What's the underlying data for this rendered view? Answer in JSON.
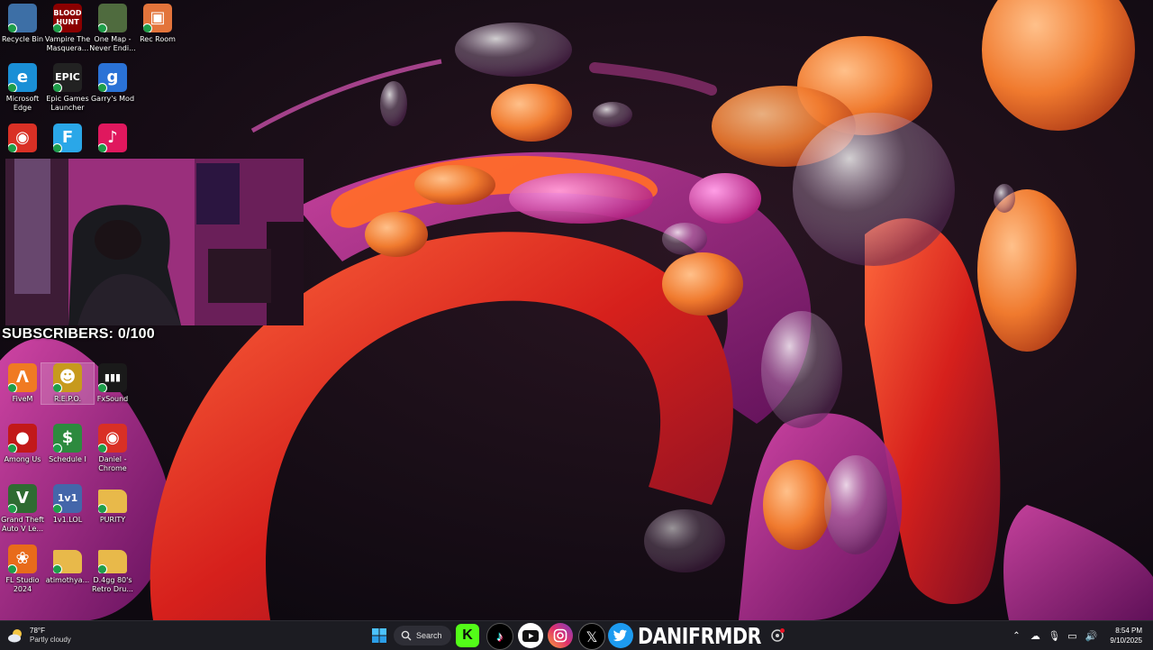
{
  "desktop": {
    "icons": [
      {
        "label": "Recycle Bin",
        "icon": "recycle-bin-icon",
        "tile": "",
        "color": "#3d6fa6"
      },
      {
        "label": "Vampire The Masquera...",
        "icon": "vampire-icon",
        "tile": "BLOOD HUNT",
        "color": "#8b0000"
      },
      {
        "label": "One Map - Never Endi...",
        "icon": "game-icon",
        "tile": "",
        "color": "#4f6b3e"
      },
      {
        "label": "Rec Room",
        "icon": "rec-room-icon",
        "tile": "▣",
        "color": "#e3743b"
      },
      {
        "label": "Microsoft Edge",
        "icon": "edge-icon",
        "tile": "e",
        "color": "#1a8fd6"
      },
      {
        "label": "Epic Games Launcher",
        "icon": "epic-games-icon",
        "tile": "EPIC",
        "color": "#222222"
      },
      {
        "label": "Garry's Mod",
        "icon": "garrys-mod-icon",
        "tile": "g",
        "color": "#2a72d6"
      },
      {
        "label": "FiveM",
        "icon": "fivem-icon",
        "tile": "Λ",
        "color": "#f07a22"
      },
      {
        "label": "R.E.P.O.",
        "icon": "repo-icon",
        "tile": "☻",
        "color": "#c79a1d"
      },
      {
        "label": "FxSound",
        "icon": "fxsound-icon",
        "tile": "▮▮▮",
        "color": "#1a1a1a"
      },
      {
        "label": "Among Us",
        "icon": "among-us-icon",
        "tile": "●",
        "color": "#c21919"
      },
      {
        "label": "Schedule I",
        "icon": "schedule-icon",
        "tile": "$",
        "color": "#2d8a3e"
      },
      {
        "label": "Daniel - Chrome",
        "icon": "chrome-icon",
        "tile": "◉",
        "color": "#d93025"
      },
      {
        "label": "Grand Theft Auto V Le...",
        "icon": "gta-icon",
        "tile": "V",
        "color": "#2f6b32"
      },
      {
        "label": "1v1.LOL",
        "icon": "1v1lol-icon",
        "tile": "1v1",
        "color": "#4466aa"
      },
      {
        "label": "PURITY",
        "icon": "folder-icon",
        "tile": "",
        "color": "#e8b94a"
      },
      {
        "label": "FL Studio 2024",
        "icon": "fl-studio-icon",
        "tile": "❀",
        "color": "#e86b1a"
      },
      {
        "label": "atimothya...",
        "icon": "folder-icon",
        "tile": "",
        "color": "#e8b94a"
      },
      {
        "label": "D.4gg 80's Retro Dru...",
        "icon": "folder-icon",
        "tile": "",
        "color": "#e8b94a"
      }
    ],
    "partial_icons": [
      {
        "label": "",
        "icon": "chrome-icon",
        "tile": "◉",
        "color": "#d93025"
      },
      {
        "label": "",
        "icon": "fortnite-icon",
        "tile": "F",
        "color": "#2aa7e8"
      },
      {
        "label": "",
        "icon": "tiktok-live-icon",
        "tile": "♪",
        "color": "#e0185e"
      }
    ]
  },
  "overlay": {
    "subscribers": "SUBSCRIBERS: 0/100"
  },
  "taskbar": {
    "weather_temp": "78°F",
    "weather_condition": "Partly cloudy",
    "search_label": "Search",
    "brand_name": "DANIFRMDR",
    "time": "8:54 PM",
    "date": "9/10/2025"
  }
}
